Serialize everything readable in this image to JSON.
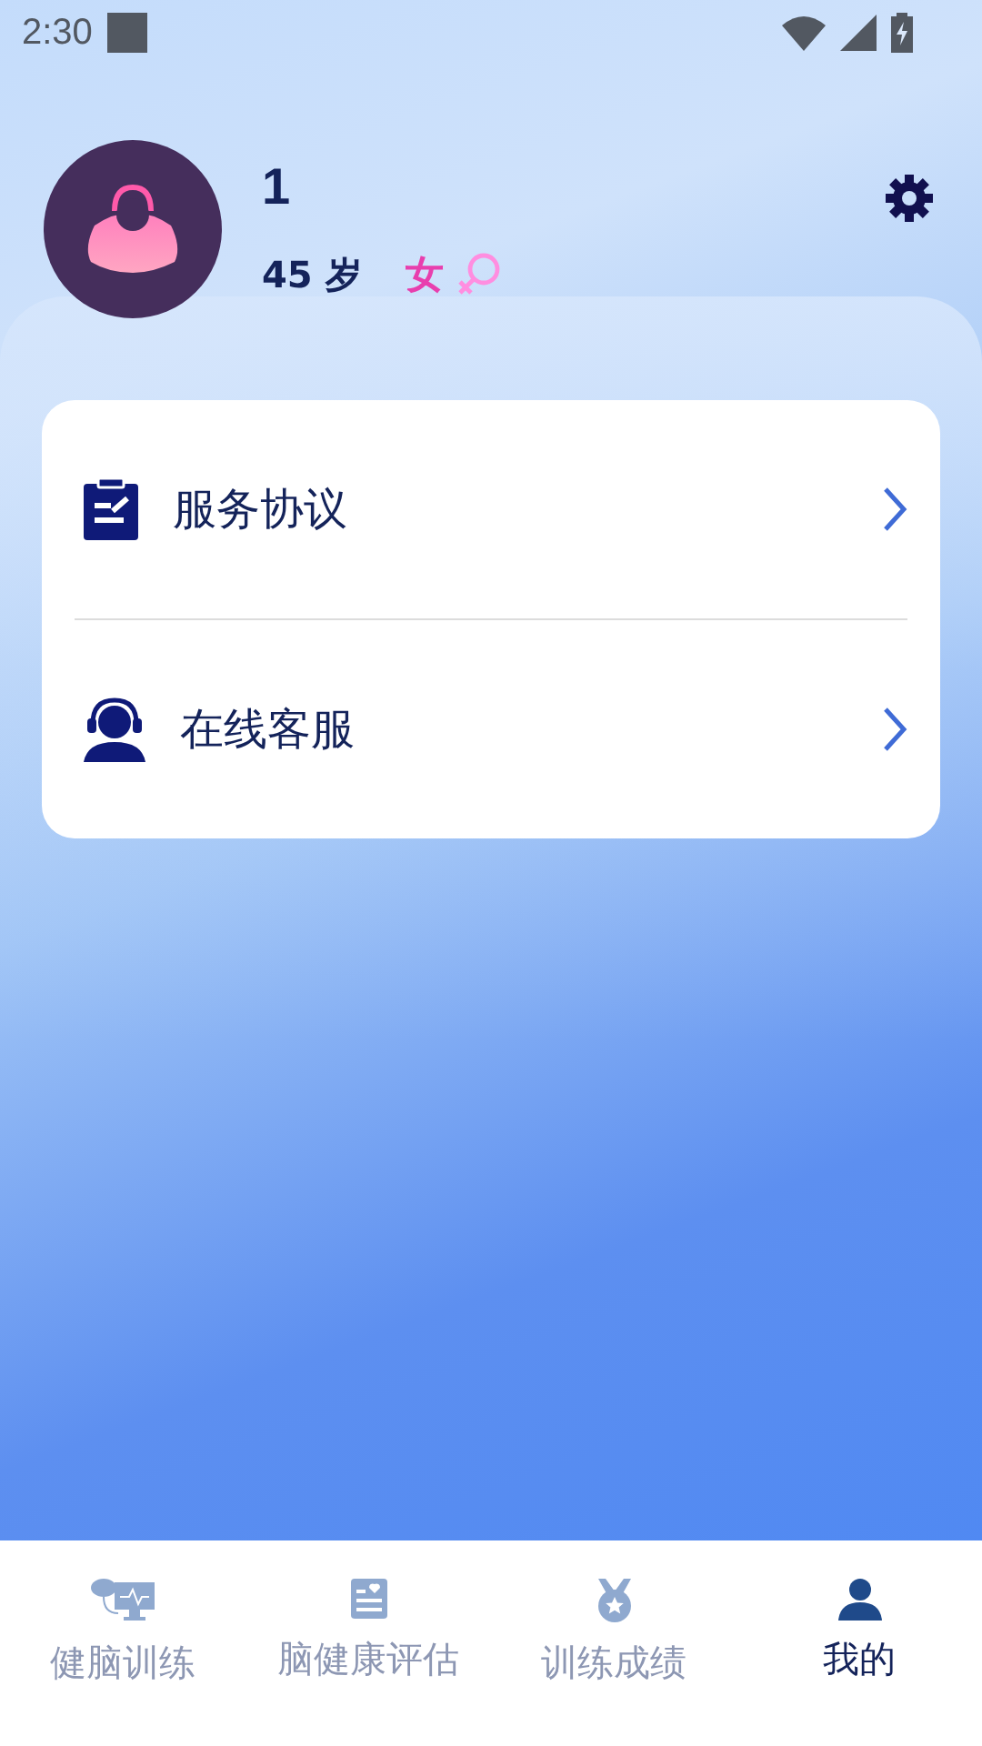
{
  "status_bar": {
    "time": "2:30"
  },
  "profile": {
    "name": "1",
    "age": "45 岁",
    "gender": "女"
  },
  "menu": [
    {
      "kind": "agreement",
      "label": "服务协议"
    },
    {
      "kind": "support",
      "label": "在线客服"
    }
  ],
  "tabs": [
    {
      "kind": "training",
      "label": "健脑训练",
      "selected": false
    },
    {
      "kind": "assessment",
      "label": "脑健康评估",
      "selected": false
    },
    {
      "kind": "results",
      "label": "训练成绩",
      "selected": false
    },
    {
      "kind": "profile",
      "label": "我的",
      "selected": true
    }
  ]
}
